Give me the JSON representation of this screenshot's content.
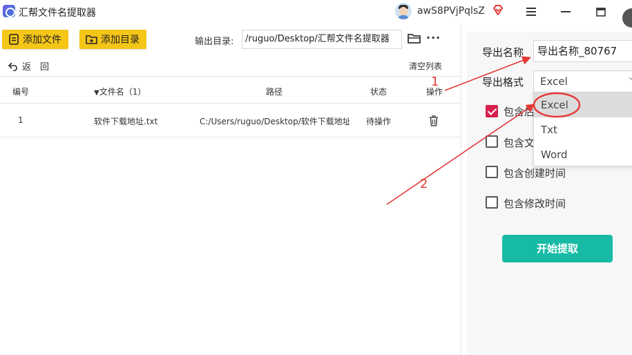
{
  "titlebar": {
    "app_title": "汇帮文件名提取器",
    "username": "awS8PVjPqlsZ"
  },
  "toolbar": {
    "add_file": "添加文件",
    "add_dir": "添加目录",
    "output_label": "输出目录:",
    "output_path": "/ruguo/Desktop/汇帮文件名提取器",
    "more": "···",
    "back": "返　回",
    "clear": "清空列表"
  },
  "table": {
    "headers": {
      "index": "编号",
      "filename": "文件名（1）",
      "path": "路径",
      "status": "状态",
      "action": "操作"
    },
    "rows": [
      {
        "index": "1",
        "filename": "软件下载地址.txt",
        "path": "C:/Users/ruguo/Desktop/软件下载地址",
        "status": "待操作"
      }
    ]
  },
  "settings": {
    "export_name_label": "导出名称",
    "export_name_value": "导出名称_80767",
    "export_format_label": "导出格式",
    "export_format_value": "Excel",
    "format_options": [
      "Excel",
      "Txt",
      "Word"
    ],
    "options": [
      {
        "label": "包含后",
        "checked": true
      },
      {
        "label": "包含文",
        "checked": false
      },
      {
        "label": "包含创建时间",
        "checked": false
      },
      {
        "label": "包含修改时间",
        "checked": false
      }
    ],
    "start_button": "开始提取"
  },
  "annotations": {
    "step1": "1",
    "step2": "2",
    "color": "#e53935"
  },
  "colors": {
    "accent_yellow": "#f5c518",
    "start_teal": "#17bba5",
    "checkbox_red": "#d6204e"
  }
}
